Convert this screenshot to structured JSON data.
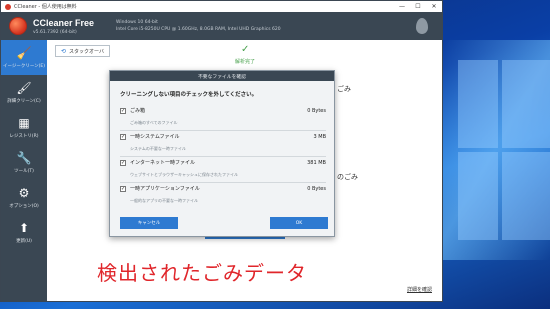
{
  "window": {
    "title": "CCleaner - 個人使用は無料",
    "min": "—",
    "max": "☐",
    "close": "✕"
  },
  "header": {
    "brand": "CCleaner Free",
    "version": "v5.61.7392 (64-bit)",
    "os": "Windows 10 64-bit",
    "hardware": "Intel Core i5-8250U CPU @ 1.60GHz, 8.0GB RAM, Intel UHD Graphics 620"
  },
  "sidebar": {
    "items": [
      {
        "label": "イージークリーン(E)",
        "icon": "broom-icon"
      },
      {
        "label": "詳細クリーン(C)",
        "icon": "brush-icon"
      },
      {
        "label": "レジストリ(R)",
        "icon": "grid-icon"
      },
      {
        "label": "ツール(T)",
        "icon": "wrench-icon"
      },
      {
        "label": "オプション(O)",
        "icon": "gear-icon"
      },
      {
        "label": "更新(U)",
        "icon": "arrow-up-icon"
      }
    ]
  },
  "main": {
    "start_over": "スタックオーバ",
    "done_label": "解析完了",
    "frag_right_top": "ごみ",
    "frag_right_mid": "のごみ",
    "details_link": "詳細を確認",
    "caption": "検出されたごみデータ"
  },
  "dialog": {
    "title": "不要なファイルを確認",
    "heading": "クリーニングしない項目のチェックを外してください。",
    "items": [
      {
        "label": "ごみ箱",
        "size": "0 Bytes",
        "desc": "ごみ箱のすべてのファイル"
      },
      {
        "label": "一時システムファイル",
        "size": "3 MB",
        "desc": "システムの不要な一時ファイル"
      },
      {
        "label": "インターネット一時ファイル",
        "size": "381 MB",
        "desc": "ウェブサイトとブラウザーキャッシュに保存されたファイル"
      },
      {
        "label": "一時アプリケーションファイル",
        "size": "0 Bytes",
        "desc": "一般的なアプリの不要な一時ファイル"
      }
    ],
    "cancel": "キャンセル",
    "ok": "OK"
  },
  "colors": {
    "accent": "#2e7ad1",
    "sidebar": "#3a4753",
    "caption": "#e0262b",
    "success": "#48a14d"
  }
}
